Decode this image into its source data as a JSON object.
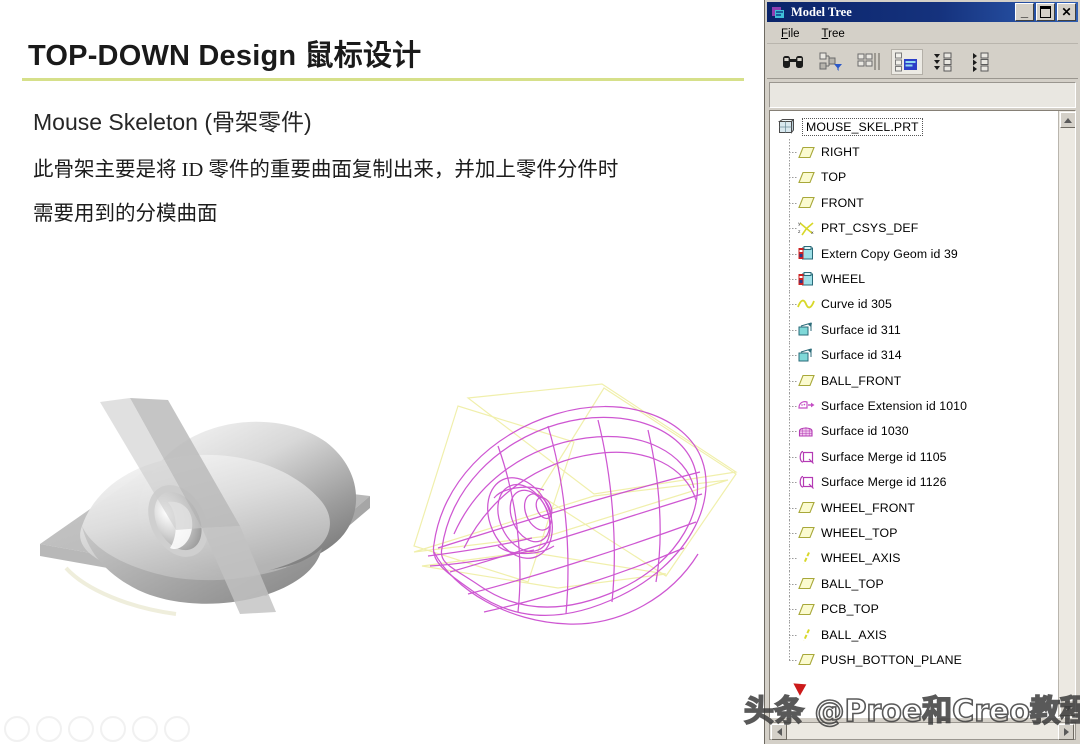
{
  "slide": {
    "title": "TOP-DOWN Design 鼠标设计",
    "subheading": "Mouse Skeleton (骨架零件)",
    "body_lines": [
      "此骨架主要是将 ID 零件的重要曲面复制出来，并加上零件分件时",
      "需要用到的分模曲面"
    ],
    "accent_rule_color": "#d6e08a",
    "figures": [
      {
        "name": "shaded-mouse-skeleton",
        "caption": ""
      },
      {
        "name": "wireframe-mouse-skeleton",
        "caption": ""
      }
    ]
  },
  "model_tree_window": {
    "title": "Model Tree",
    "app_icon": "model-tree-icon",
    "titlebar_color": "#0a246a",
    "window_buttons": [
      {
        "name": "minimize-button",
        "glyph": "_"
      },
      {
        "name": "maximize-button",
        "glyph": "□"
      },
      {
        "name": "close-button",
        "glyph": "✕"
      }
    ],
    "menu": [
      {
        "name": "file",
        "label": "File",
        "mnemonic": "F"
      },
      {
        "name": "tree",
        "label": "Tree",
        "mnemonic": "T"
      }
    ],
    "toolbar": [
      {
        "name": "find-binoculars-icon",
        "label": "Find",
        "active": false
      },
      {
        "name": "tree-filters-icon",
        "label": "Tree Filters",
        "active": false
      },
      {
        "name": "tree-columns-icon",
        "label": "Tree Columns",
        "active": false
      },
      {
        "name": "show-model-tree-icon",
        "label": "Model Tree",
        "active": true
      },
      {
        "name": "expand-all-icon",
        "label": "Expand All",
        "active": false
      },
      {
        "name": "collapse-all-icon",
        "label": "Collapse All",
        "active": false
      }
    ],
    "tree": {
      "root": {
        "label": "MOUSE_SKEL.PRT",
        "icon": "part-icon",
        "selected": true
      },
      "items": [
        {
          "label": "RIGHT",
          "icon": "datum-plane-icon"
        },
        {
          "label": "TOP",
          "icon": "datum-plane-icon"
        },
        {
          "label": "FRONT",
          "icon": "datum-plane-icon"
        },
        {
          "label": "PRT_CSYS_DEF",
          "icon": "coordinate-system-icon"
        },
        {
          "label": "Extern Copy Geom id 39",
          "icon": "external-copy-geom-icon"
        },
        {
          "label": "WHEEL",
          "icon": "external-copy-geom-icon"
        },
        {
          "label": "Curve id 305",
          "icon": "curve-icon"
        },
        {
          "label": "Surface id 311",
          "icon": "surface-icon"
        },
        {
          "label": "Surface id 314",
          "icon": "surface-icon"
        },
        {
          "label": "BALL_FRONT",
          "icon": "datum-plane-icon"
        },
        {
          "label": "Surface Extension id 1010",
          "icon": "surface-extension-icon"
        },
        {
          "label": "Surface id 1030",
          "icon": "surface-mesh-icon"
        },
        {
          "label": "Surface Merge id 1105",
          "icon": "surface-merge-icon"
        },
        {
          "label": "Surface Merge id 1126",
          "icon": "surface-merge-icon"
        },
        {
          "label": "WHEEL_FRONT",
          "icon": "datum-plane-icon"
        },
        {
          "label": "WHEEL_TOP",
          "icon": "datum-plane-icon"
        },
        {
          "label": "WHEEL_AXIS",
          "icon": "datum-axis-icon"
        },
        {
          "label": "BALL_TOP",
          "icon": "datum-plane-icon"
        },
        {
          "label": "PCB_TOP",
          "icon": "datum-plane-icon"
        },
        {
          "label": "BALL_AXIS",
          "icon": "datum-axis-icon"
        },
        {
          "label": "PUSH_BOTTON_PLANE",
          "icon": "datum-plane-icon"
        }
      ]
    },
    "scrollbars": {
      "vertical": {
        "up_arrow": "▲",
        "down_arrow": "▼"
      },
      "horizontal": {
        "left_arrow": "◀",
        "right_arrow": "▶"
      }
    }
  },
  "watermark": {
    "text": "头条 @Proe和Creo教程"
  }
}
